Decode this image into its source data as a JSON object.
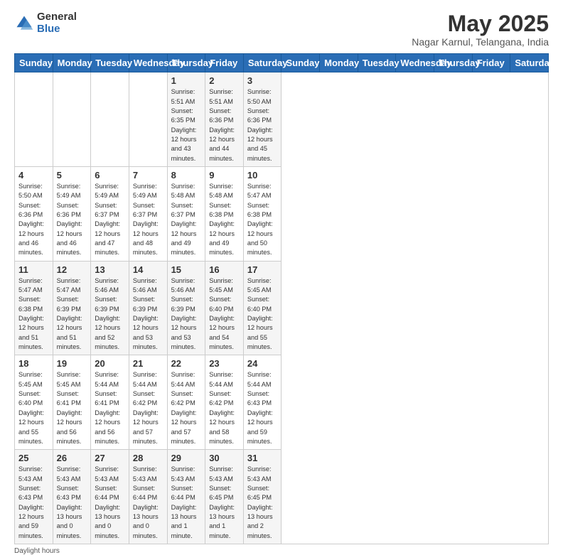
{
  "logo": {
    "general": "General",
    "blue": "Blue"
  },
  "title": "May 2025",
  "subtitle": "Nagar Karnul, Telangana, India",
  "footer": "Daylight hours",
  "days_of_week": [
    "Sunday",
    "Monday",
    "Tuesday",
    "Wednesday",
    "Thursday",
    "Friday",
    "Saturday"
  ],
  "weeks": [
    [
      {
        "day": "",
        "info": ""
      },
      {
        "day": "",
        "info": ""
      },
      {
        "day": "",
        "info": ""
      },
      {
        "day": "",
        "info": ""
      },
      {
        "day": "1",
        "info": "Sunrise: 5:51 AM\nSunset: 6:35 PM\nDaylight: 12 hours\nand 43 minutes."
      },
      {
        "day": "2",
        "info": "Sunrise: 5:51 AM\nSunset: 6:36 PM\nDaylight: 12 hours\nand 44 minutes."
      },
      {
        "day": "3",
        "info": "Sunrise: 5:50 AM\nSunset: 6:36 PM\nDaylight: 12 hours\nand 45 minutes."
      }
    ],
    [
      {
        "day": "4",
        "info": "Sunrise: 5:50 AM\nSunset: 6:36 PM\nDaylight: 12 hours\nand 46 minutes."
      },
      {
        "day": "5",
        "info": "Sunrise: 5:49 AM\nSunset: 6:36 PM\nDaylight: 12 hours\nand 46 minutes."
      },
      {
        "day": "6",
        "info": "Sunrise: 5:49 AM\nSunset: 6:37 PM\nDaylight: 12 hours\nand 47 minutes."
      },
      {
        "day": "7",
        "info": "Sunrise: 5:49 AM\nSunset: 6:37 PM\nDaylight: 12 hours\nand 48 minutes."
      },
      {
        "day": "8",
        "info": "Sunrise: 5:48 AM\nSunset: 6:37 PM\nDaylight: 12 hours\nand 49 minutes."
      },
      {
        "day": "9",
        "info": "Sunrise: 5:48 AM\nSunset: 6:38 PM\nDaylight: 12 hours\nand 49 minutes."
      },
      {
        "day": "10",
        "info": "Sunrise: 5:47 AM\nSunset: 6:38 PM\nDaylight: 12 hours\nand 50 minutes."
      }
    ],
    [
      {
        "day": "11",
        "info": "Sunrise: 5:47 AM\nSunset: 6:38 PM\nDaylight: 12 hours\nand 51 minutes."
      },
      {
        "day": "12",
        "info": "Sunrise: 5:47 AM\nSunset: 6:39 PM\nDaylight: 12 hours\nand 51 minutes."
      },
      {
        "day": "13",
        "info": "Sunrise: 5:46 AM\nSunset: 6:39 PM\nDaylight: 12 hours\nand 52 minutes."
      },
      {
        "day": "14",
        "info": "Sunrise: 5:46 AM\nSunset: 6:39 PM\nDaylight: 12 hours\nand 53 minutes."
      },
      {
        "day": "15",
        "info": "Sunrise: 5:46 AM\nSunset: 6:39 PM\nDaylight: 12 hours\nand 53 minutes."
      },
      {
        "day": "16",
        "info": "Sunrise: 5:45 AM\nSunset: 6:40 PM\nDaylight: 12 hours\nand 54 minutes."
      },
      {
        "day": "17",
        "info": "Sunrise: 5:45 AM\nSunset: 6:40 PM\nDaylight: 12 hours\nand 55 minutes."
      }
    ],
    [
      {
        "day": "18",
        "info": "Sunrise: 5:45 AM\nSunset: 6:40 PM\nDaylight: 12 hours\nand 55 minutes."
      },
      {
        "day": "19",
        "info": "Sunrise: 5:45 AM\nSunset: 6:41 PM\nDaylight: 12 hours\nand 56 minutes."
      },
      {
        "day": "20",
        "info": "Sunrise: 5:44 AM\nSunset: 6:41 PM\nDaylight: 12 hours\nand 56 minutes."
      },
      {
        "day": "21",
        "info": "Sunrise: 5:44 AM\nSunset: 6:42 PM\nDaylight: 12 hours\nand 57 minutes."
      },
      {
        "day": "22",
        "info": "Sunrise: 5:44 AM\nSunset: 6:42 PM\nDaylight: 12 hours\nand 57 minutes."
      },
      {
        "day": "23",
        "info": "Sunrise: 5:44 AM\nSunset: 6:42 PM\nDaylight: 12 hours\nand 58 minutes."
      },
      {
        "day": "24",
        "info": "Sunrise: 5:44 AM\nSunset: 6:43 PM\nDaylight: 12 hours\nand 59 minutes."
      }
    ],
    [
      {
        "day": "25",
        "info": "Sunrise: 5:43 AM\nSunset: 6:43 PM\nDaylight: 12 hours\nand 59 minutes."
      },
      {
        "day": "26",
        "info": "Sunrise: 5:43 AM\nSunset: 6:43 PM\nDaylight: 13 hours\nand 0 minutes."
      },
      {
        "day": "27",
        "info": "Sunrise: 5:43 AM\nSunset: 6:44 PM\nDaylight: 13 hours\nand 0 minutes."
      },
      {
        "day": "28",
        "info": "Sunrise: 5:43 AM\nSunset: 6:44 PM\nDaylight: 13 hours\nand 0 minutes."
      },
      {
        "day": "29",
        "info": "Sunrise: 5:43 AM\nSunset: 6:44 PM\nDaylight: 13 hours\nand 1 minute."
      },
      {
        "day": "30",
        "info": "Sunrise: 5:43 AM\nSunset: 6:45 PM\nDaylight: 13 hours\nand 1 minute."
      },
      {
        "day": "31",
        "info": "Sunrise: 5:43 AM\nSunset: 6:45 PM\nDaylight: 13 hours\nand 2 minutes."
      }
    ]
  ]
}
